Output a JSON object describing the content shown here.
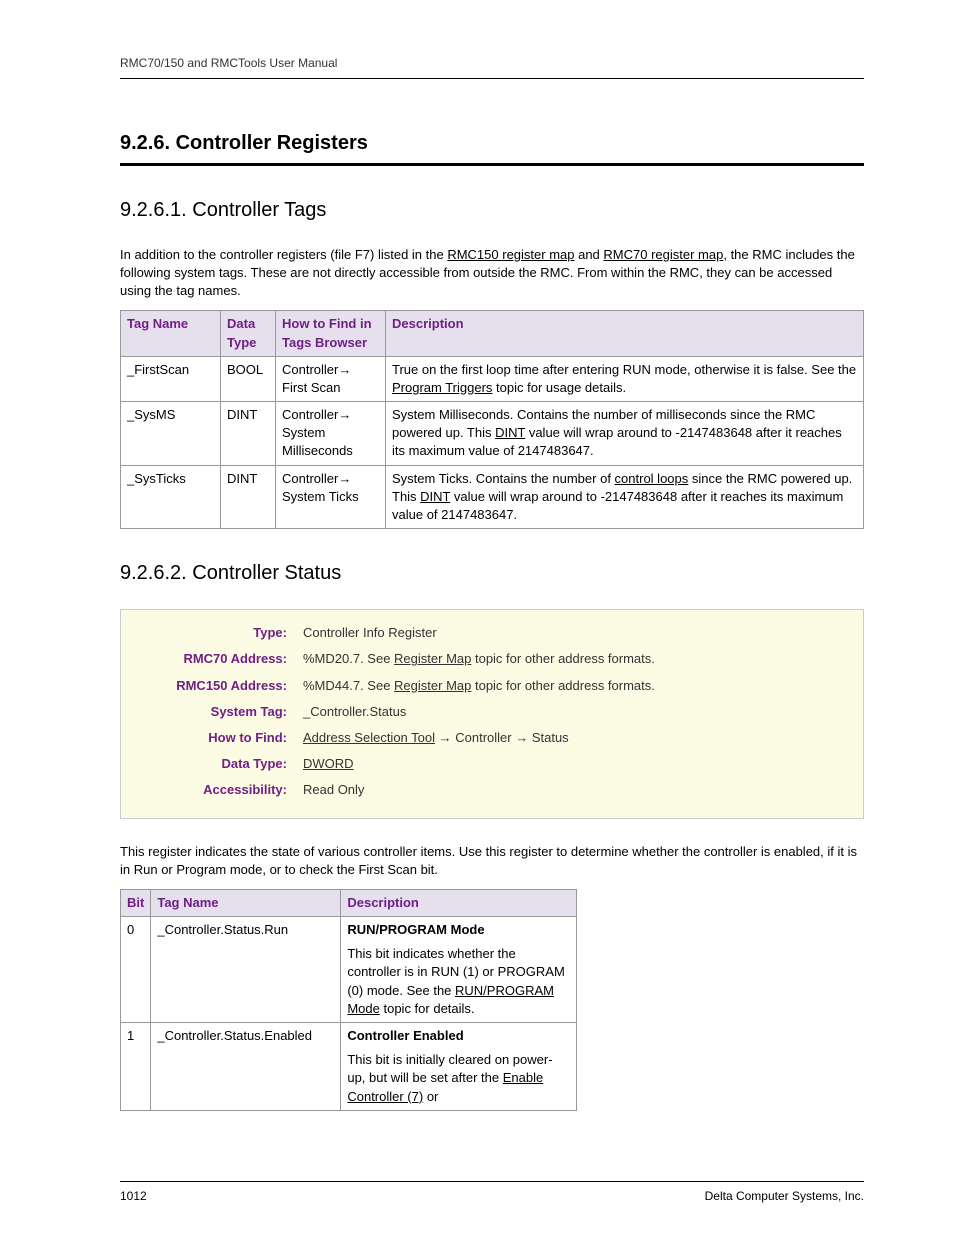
{
  "header": "RMC70/150 and RMCTools User Manual",
  "h1": "9.2.6. Controller Registers",
  "h2a": "9.2.6.1. Controller Tags",
  "intro_a": "In addition to the controller registers (file F7) listed in the ",
  "intro_link1": "RMC150 register map",
  "intro_mid": " and ",
  "intro_link2": "RMC70 register map",
  "intro_b": ", the RMC includes the following system tags. These are not directly accessible from outside the RMC. From within the RMC, they can be accessed using the tag names.",
  "t1": {
    "h": [
      "Tag Name",
      "Data Type",
      "How to Find in Tags Browser",
      "Description"
    ],
    "rows": [
      {
        "c0": "_FirstScan",
        "c1": "BOOL",
        "c2": "Controller→ First Scan",
        "d_a": "True on the first loop time after entering RUN mode, otherwise it is false. See the ",
        "d_link": "Program Triggers",
        "d_b": " topic for usage details."
      },
      {
        "c0": "_SysMS",
        "c1": "DINT",
        "c2": "Controller→ System Milliseconds",
        "d_a": "System Milliseconds. Contains the number of milliseconds since the RMC powered up. This ",
        "d_link": "DINT",
        "d_b": " value will wrap around to -2147483648 after it reaches its maximum value of 2147483647."
      },
      {
        "c0": "_SysTicks",
        "c1": "DINT",
        "c2": "Controller→ System Ticks",
        "d_a": "System Ticks. Contains the number of ",
        "d_link": "control loops",
        "d_mid": " since the RMC powered up. This ",
        "d_link2": "DINT",
        "d_b": " value will wrap around to -2147483648 after it reaches its maximum value of 2147483647."
      }
    ]
  },
  "h2b": "9.2.6.2. Controller Status",
  "info": [
    {
      "label": "Type:",
      "value": "Controller Info Register"
    },
    {
      "label": "RMC70 Address:",
      "pre": "%MD20.7. See ",
      "link": "Register Map",
      "post": " topic for other address formats."
    },
    {
      "label": "RMC150 Address:",
      "pre": "%MD44.7. See ",
      "link": "Register Map",
      "post": " topic for other address formats."
    },
    {
      "label": "System Tag:",
      "value": "_Controller.Status"
    },
    {
      "label": "How to Find:",
      "link": "Address Selection Tool",
      "post": " → Controller → Status"
    },
    {
      "label": "Data Type:",
      "link": "DWORD"
    },
    {
      "label": "Accessibility:",
      "value": "Read Only"
    }
  ],
  "para2": "This register indicates the state of various controller items. Use this register to determine whether the controller is enabled, if it is in Run or Program mode, or to check the First Scan bit.",
  "t2": {
    "h": [
      "Bit",
      "Tag Name",
      "Description"
    ],
    "rows": [
      {
        "c0": "0",
        "c1": "_Controller.Status.Run",
        "title": "RUN/PROGRAM Mode",
        "d_a": "This bit indicates whether the controller is in RUN (1) or PROGRAM (0) mode. See the ",
        "d_link": "RUN/PROGRAM Mode",
        "d_b": " topic for details."
      },
      {
        "c0": "1",
        "c1": "_Controller.Status.Enabled",
        "title": "Controller Enabled",
        "d_a": "This bit is initially cleared on power-up, but will be set after the ",
        "d_link": "Enable Controller (7)",
        "d_b": " or"
      }
    ]
  },
  "footer_left": "1012",
  "footer_right": "Delta Computer Systems, Inc."
}
